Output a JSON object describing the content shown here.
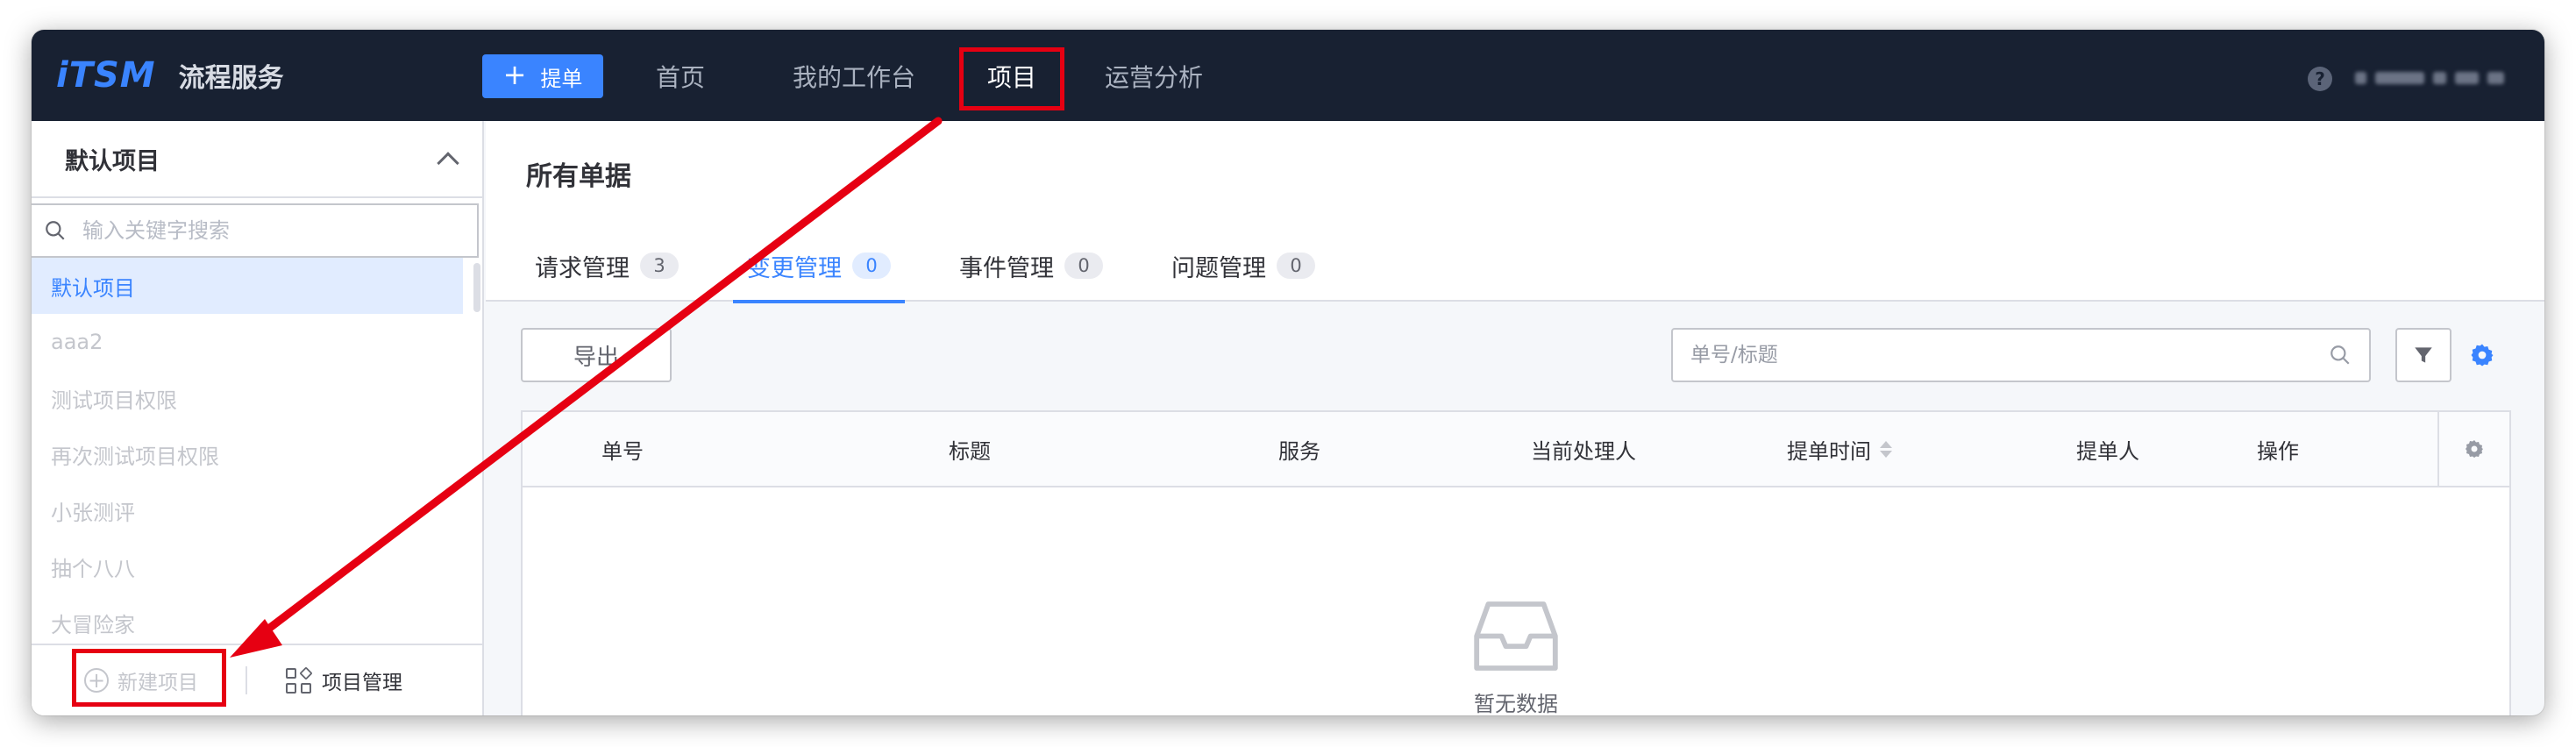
{
  "app": {
    "logo_text": "iTSM",
    "name": "流程服务"
  },
  "topbar": {
    "new_ticket_label": "提单",
    "nav": [
      "首页",
      "我的工作台",
      "项目",
      "运营分析"
    ],
    "active_nav": "项目",
    "help_icon": "question-circle-icon"
  },
  "sidebar": {
    "title": "默认项目",
    "search_placeholder": "输入关键字搜索",
    "projects": [
      "默认项目",
      "aaa2",
      "测试项目权限",
      "再次测试项目权限",
      "小张测评",
      "抽个八八",
      "大冒险家"
    ],
    "selected_project": "默认项目",
    "footer": {
      "new_project_label": "新建项目",
      "manage_project_label": "项目管理"
    }
  },
  "main": {
    "title": "所有单据",
    "tabs": [
      {
        "label": "请求管理",
        "count": "3"
      },
      {
        "label": "变更管理",
        "count": "0"
      },
      {
        "label": "事件管理",
        "count": "0"
      },
      {
        "label": "问题管理",
        "count": "0"
      }
    ],
    "active_tab": "变更管理",
    "export_label": "导出",
    "search_placeholder": "单号/标题",
    "table": {
      "columns": [
        "单号",
        "标题",
        "服务",
        "当前处理人",
        "提单时间",
        "提单人",
        "操作"
      ],
      "empty_text": "暂无数据"
    }
  },
  "annotation": {
    "color": "#e60012"
  },
  "colors": {
    "accent": "#3a84ff",
    "topbar_bg": "#182132",
    "highlight": "#e60012"
  }
}
